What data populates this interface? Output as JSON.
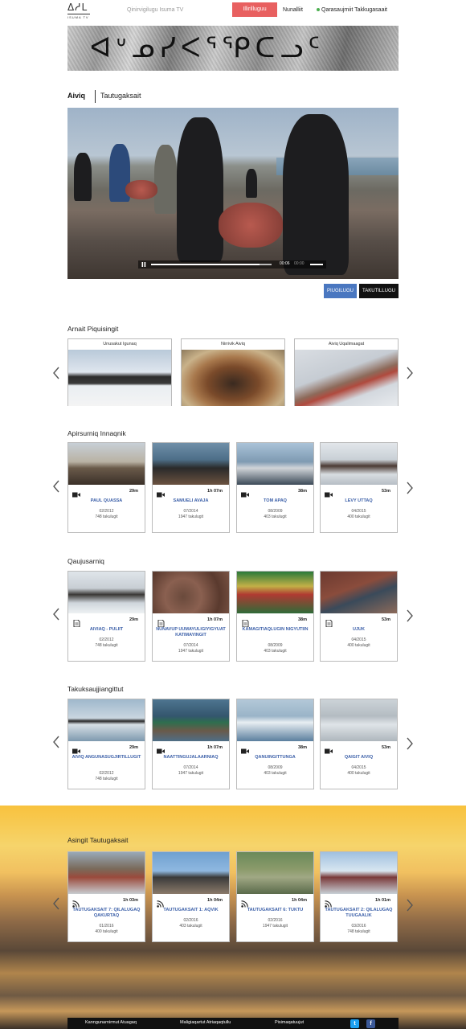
{
  "header": {
    "logo_glyphs": "ᐃᓱᒪ",
    "logo_sub": "ISUMA TV",
    "search_placeholder": "Qinirvigilugu Isuma TV",
    "register_label": "Illirilluguu",
    "login_label": "Nunalliit",
    "language_label": "Qarasaujmiit Takkugasaait"
  },
  "banner": {
    "syllabics": "ᐊᐡᓄᓯᐸᕐᕿᑕᓗᑦ"
  },
  "tabs": {
    "active": "Aiviq",
    "other": "Tautugaksait"
  },
  "video": {
    "time_current": "00:06",
    "time_total": "00:00",
    "progress": 0.9,
    "watch_label": "PIUGILUGU",
    "download_label": "TAKUTILLUGU"
  },
  "sections": {
    "featured": "Arnait Piquisingit",
    "recent": "Apirsurniq Innaqnik",
    "research": "Qaujusarniq",
    "watched": "Takuksaujjiangittut",
    "other": "Asingit Tautugaksait"
  },
  "featured_cards": [
    {
      "label": "Unusakut Igunaq"
    },
    {
      "label": "Nirrivik Aiviq"
    },
    {
      "label": "Aiviq Uqalimaagat"
    }
  ],
  "recent_cards": [
    {
      "duration": "29m",
      "title": "PAUL QUASSA",
      "date": "02/2012",
      "views": "748 takulugit",
      "icon": "video-icon"
    },
    {
      "duration": "1h 07m",
      "title": "SAMUELI AVAJA",
      "date": "07/2014",
      "views": "1947 takulugit",
      "icon": "video-icon"
    },
    {
      "duration": "38m",
      "title": "TOM APAQ",
      "date": "08/2009",
      "views": "403 takulugit",
      "icon": "video-icon"
    },
    {
      "duration": "53m",
      "title": "LEVY UTTAQ",
      "date": "04/2015",
      "views": "400 takulugit",
      "icon": "video-icon"
    }
  ],
  "research_cards": [
    {
      "duration": "29m",
      "title": "AIVIAQ - PULIIT",
      "date": "02/2012",
      "views": "748 takulugit",
      "icon": "document-icon"
    },
    {
      "duration": "1h 07m",
      "title": "NUNAVUP UUMAYULIGIYIGYUAT KATIMAYINGIT",
      "date": "07/2014",
      "views": "1947 takulugit",
      "icon": "document-icon"
    },
    {
      "duration": "38m",
      "title": "KAMAGITIAQLUGIN NIGYUTIIN",
      "date": "08/2009",
      "views": "403 takulugit",
      "icon": "document-icon"
    },
    {
      "duration": "53m",
      "title": "UJUK",
      "date": "04/2015",
      "views": "400 takulugit",
      "icon": "document-icon"
    }
  ],
  "watched_cards": [
    {
      "duration": "29m",
      "title": "AIVIQ ANGUNASUGJIRTILLUGIT",
      "date": "02/2012",
      "views": "748 takulugit",
      "icon": "video-icon"
    },
    {
      "duration": "1h 07m",
      "title": "NAATTINGUJALAARNIAQ",
      "date": "07/2014",
      "views": "1947 takulugit",
      "icon": "video-icon"
    },
    {
      "duration": "38m",
      "title": "QANUINGITTUNGA",
      "date": "08/2009",
      "views": "403 takulugit",
      "icon": "video-icon"
    },
    {
      "duration": "53m",
      "title": "QAIGIT AIVIQ",
      "date": "04/2015",
      "views": "400 takulugit",
      "icon": "video-icon"
    }
  ],
  "other_cards": [
    {
      "duration": "1h 03m",
      "title": "TAUTUGAKSAIT 7: QILALUGAQ QAKURTAQ",
      "date": "01/2016",
      "views": "400 takulugit",
      "icon": "rss-icon"
    },
    {
      "duration": "1h 04m",
      "title": "TAUTUGAKSAIT 1: AQVIK",
      "date": "02/2016",
      "views": "403 takulugit",
      "icon": "rss-icon"
    },
    {
      "duration": "1h 04m",
      "title": "TAUTUGAKSAIT 6: TUKTU",
      "date": "02/2016",
      "views": "1947 takulugit",
      "icon": "rss-icon"
    },
    {
      "duration": "1h 01m",
      "title": "TAUTUGAKSAIT 2: QILALUGAQ TUUGAALIK",
      "date": "03/2016",
      "views": "748 takulugit",
      "icon": "rss-icon"
    }
  ],
  "footer": {
    "link1": "Kanngunarnirmut Atuagaq",
    "link2": "Maligiaqartut Atriaqaqtullu",
    "link3": "Pisimaqatuujut",
    "twitter": "t",
    "facebook": "f"
  },
  "colors": {
    "register": "#e86060",
    "watch": "#4a77c0",
    "link_title": "#3b5fa8",
    "twitter": "#1da1f2",
    "facebook": "#3b5998"
  }
}
